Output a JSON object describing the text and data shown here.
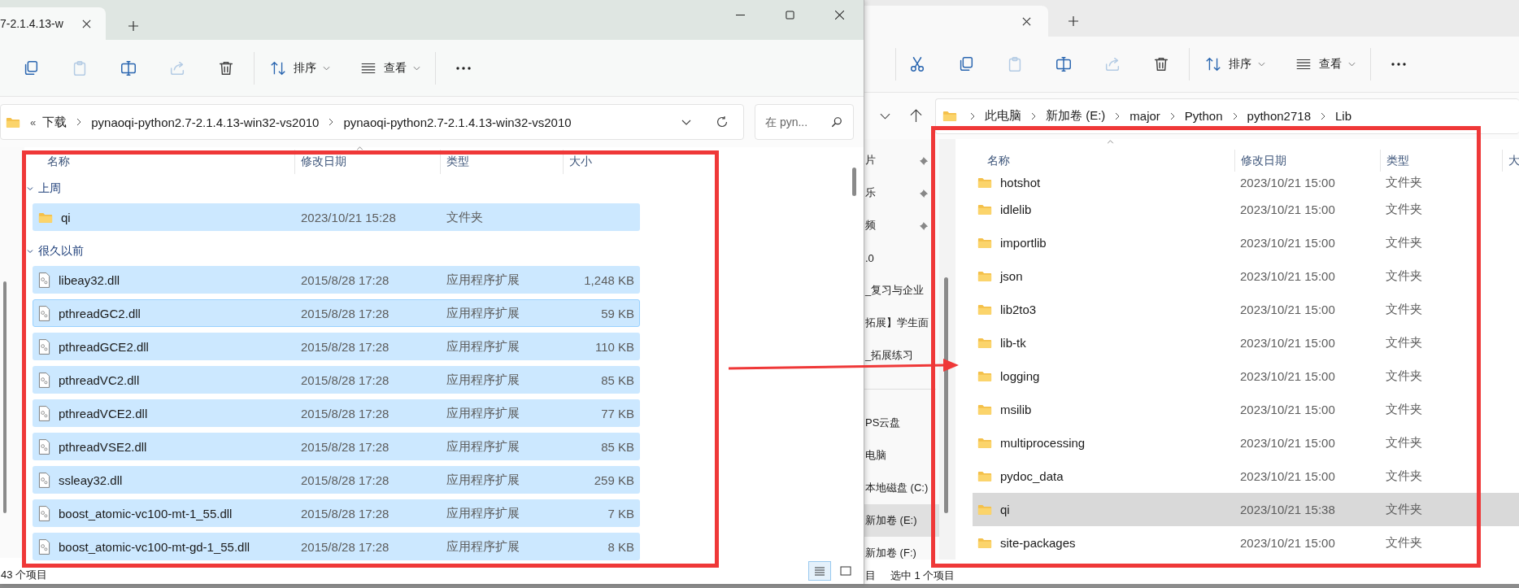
{
  "left_window": {
    "tab": {
      "title": "7-2.1.4.13-w"
    },
    "toolbar": {
      "buttons": [
        {
          "kind": "copy",
          "disabled": false
        },
        {
          "kind": "paste",
          "disabled": true
        },
        {
          "kind": "rename",
          "disabled": false
        },
        {
          "kind": "share",
          "disabled": true
        },
        {
          "kind": "delete",
          "disabled": false
        }
      ],
      "sort": "排序",
      "view": "查看"
    },
    "address": {
      "overflow": "«",
      "segments": [
        "下载",
        "pynaoqi-python2.7-2.1.4.13-win32-vs2010",
        "pynaoqi-python2.7-2.1.4.13-win32-vs2010"
      ]
    },
    "search": {
      "placeholder": "在 pyn..."
    },
    "columns": [
      "名称",
      "修改日期",
      "类型",
      "大小"
    ],
    "groups": [
      {
        "label": "上周",
        "expanded": true,
        "rows": [
          {
            "kind": "folder",
            "name": "qi",
            "date": "2023/10/21 15:28",
            "type": "文件夹",
            "size": "",
            "selected": true,
            "focused": false
          }
        ]
      },
      {
        "label": "很久以前",
        "expanded": true,
        "rows": [
          {
            "kind": "dll",
            "name": "libeay32.dll",
            "date": "2015/8/28 17:28",
            "type": "应用程序扩展",
            "size": "1,248 KB",
            "selected": true,
            "focused": false
          },
          {
            "kind": "dll",
            "name": "pthreadGC2.dll",
            "date": "2015/8/28 17:28",
            "type": "应用程序扩展",
            "size": "59 KB",
            "selected": true,
            "focused": true
          },
          {
            "kind": "dll",
            "name": "pthreadGCE2.dll",
            "date": "2015/8/28 17:28",
            "type": "应用程序扩展",
            "size": "110 KB",
            "selected": true,
            "focused": false
          },
          {
            "kind": "dll",
            "name": "pthreadVC2.dll",
            "date": "2015/8/28 17:28",
            "type": "应用程序扩展",
            "size": "85 KB",
            "selected": true,
            "focused": false
          },
          {
            "kind": "dll",
            "name": "pthreadVCE2.dll",
            "date": "2015/8/28 17:28",
            "type": "应用程序扩展",
            "size": "77 KB",
            "selected": true,
            "focused": false
          },
          {
            "kind": "dll",
            "name": "pthreadVSE2.dll",
            "date": "2015/8/28 17:28",
            "type": "应用程序扩展",
            "size": "85 KB",
            "selected": true,
            "focused": false
          },
          {
            "kind": "dll",
            "name": "ssleay32.dll",
            "date": "2015/8/28 17:28",
            "type": "应用程序扩展",
            "size": "259 KB",
            "selected": true,
            "focused": false
          },
          {
            "kind": "dll",
            "name": "boost_atomic-vc100-mt-1_55.dll",
            "date": "2015/8/28 17:28",
            "type": "应用程序扩展",
            "size": "7 KB",
            "selected": true,
            "focused": false
          },
          {
            "kind": "dll",
            "name": "boost_atomic-vc100-mt-gd-1_55.dll",
            "date": "2015/8/28 17:28",
            "type": "应用程序扩展",
            "size": "8 KB",
            "selected": true,
            "focused": false
          }
        ]
      }
    ],
    "status_bar": {
      "count": "43 个项目"
    },
    "view_buttons": [
      {
        "kind": "details",
        "selected": true
      },
      {
        "kind": "tiles",
        "selected": false
      }
    ]
  },
  "right_window": {
    "toolbar": {
      "buttons": [
        {
          "kind": "cut",
          "disabled": false
        },
        {
          "kind": "copy",
          "disabled": false
        },
        {
          "kind": "paste",
          "disabled": true
        },
        {
          "kind": "rename",
          "disabled": false
        },
        {
          "kind": "share",
          "disabled": true
        },
        {
          "kind": "delete",
          "disabled": false
        }
      ],
      "sort": "排序",
      "view": "查看"
    },
    "address": {
      "segments": [
        "此电脑",
        "新加卷 (E:)",
        "major",
        "Python",
        "python2718",
        "Lib"
      ]
    },
    "nav_pane": {
      "quick_access": [
        {
          "label": "片",
          "pinned": true
        },
        {
          "label": "乐",
          "pinned": true
        },
        {
          "label": "频",
          "pinned": true
        },
        {
          "label": ".0",
          "pinned": false
        },
        {
          "label": "_复习与企业",
          "pinned": false
        },
        {
          "label": "拓展】学生面",
          "pinned": false
        },
        {
          "label": "_拓展练习",
          "pinned": false
        }
      ],
      "locations": [
        {
          "label": "PS云盘",
          "selected": false
        },
        {
          "label": "电脑",
          "selected": false
        },
        {
          "label": "本地磁盘 (C:)",
          "selected": false
        },
        {
          "label": "新加卷 (E:)",
          "selected": true
        },
        {
          "label": "新加卷 (F:)",
          "selected": false
        }
      ]
    },
    "columns": [
      "名称",
      "修改日期",
      "类型",
      "大"
    ],
    "rows": [
      {
        "name": "hotshot",
        "date": "2023/10/21 15:00",
        "type": "文件夹",
        "selected": false
      },
      {
        "name": "idlelib",
        "date": "2023/10/21 15:00",
        "type": "文件夹",
        "selected": false
      },
      {
        "name": "importlib",
        "date": "2023/10/21 15:00",
        "type": "文件夹",
        "selected": false
      },
      {
        "name": "json",
        "date": "2023/10/21 15:00",
        "type": "文件夹",
        "selected": false
      },
      {
        "name": "lib2to3",
        "date": "2023/10/21 15:00",
        "type": "文件夹",
        "selected": false
      },
      {
        "name": "lib-tk",
        "date": "2023/10/21 15:00",
        "type": "文件夹",
        "selected": false
      },
      {
        "name": "logging",
        "date": "2023/10/21 15:00",
        "type": "文件夹",
        "selected": false
      },
      {
        "name": "msilib",
        "date": "2023/10/21 15:00",
        "type": "文件夹",
        "selected": false
      },
      {
        "name": "multiprocessing",
        "date": "2023/10/21 15:00",
        "type": "文件夹",
        "selected": false
      },
      {
        "name": "pydoc_data",
        "date": "2023/10/21 15:00",
        "type": "文件夹",
        "selected": false
      },
      {
        "name": "qi",
        "date": "2023/10/21 15:38",
        "type": "文件夹",
        "selected": true
      },
      {
        "name": "site-packages",
        "date": "2023/10/21 15:00",
        "type": "文件夹",
        "selected": false
      }
    ],
    "status_bar": {
      "count": "目",
      "selection": "选中 1 个项目"
    }
  }
}
